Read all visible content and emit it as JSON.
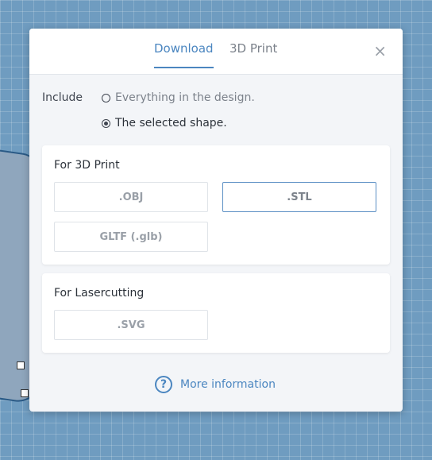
{
  "tabs": [
    {
      "label": "Download",
      "active": true
    },
    {
      "label": "3D Print",
      "active": false
    }
  ],
  "close_icon": "×",
  "include": {
    "label": "Include",
    "options": [
      {
        "label": "Everything in the design.",
        "selected": false
      },
      {
        "label": "The selected shape.",
        "selected": true
      }
    ]
  },
  "sections": {
    "print": {
      "title": "For 3D Print",
      "buttons": [
        ".OBJ",
        ".STL",
        "GLTF (.glb)"
      ],
      "selected": ".STL"
    },
    "laser": {
      "title": "For Lasercutting",
      "buttons": [
        ".SVG"
      ]
    }
  },
  "more_info": {
    "label": "More information",
    "icon": "question-circle-icon",
    "icon_glyph": "?"
  },
  "colors": {
    "accent": "#4b86c0",
    "background": "#6f9cc0"
  }
}
